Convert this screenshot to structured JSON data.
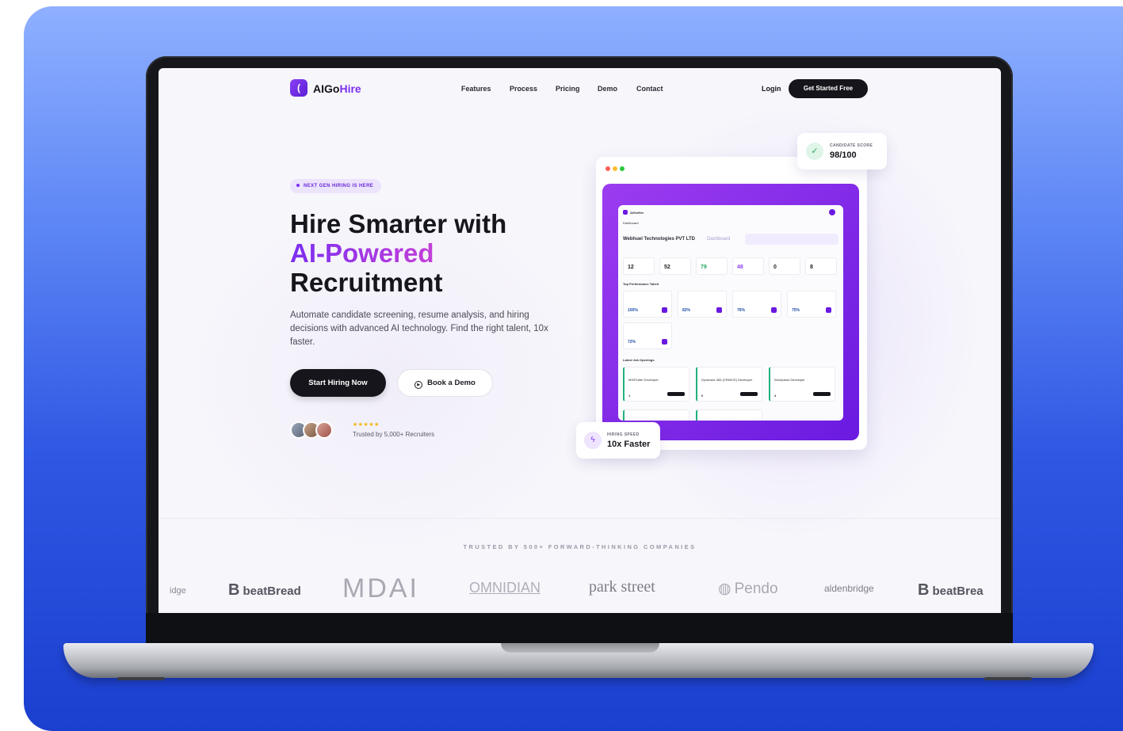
{
  "nav": {
    "logo_icon": "(",
    "logo_prefix": "AIGo",
    "logo_highlight": "Hire",
    "links": [
      "Features",
      "Process",
      "Pricing",
      "Demo",
      "Contact"
    ],
    "login": "Login",
    "cta": "Get Started Free"
  },
  "hero": {
    "badge": "NEXT GEN HIRING IS HERE",
    "headline_line1": "Hire Smarter with",
    "headline_line2": "AI-Powered",
    "headline_line3": "Recruitment",
    "subtext": "Automate candidate screening, resume analysis, and hiring decisions with advanced AI technology. Find the right talent, 10x faster.",
    "primary_button": "Start Hiring Now",
    "secondary_button": "Book a Demo",
    "stars": "★★★★★",
    "trusted": "Trusted by 5,000+ Recruiters"
  },
  "score_card": {
    "label": "CANDIDATE SCORE",
    "value": "98/100",
    "icon": "check-icon"
  },
  "speed_card": {
    "label": "HIRING SPEED",
    "value": "10x Faster",
    "icon": "lightning-icon"
  },
  "dashboard": {
    "brand": "AIGoHire",
    "section": "Dashboard",
    "company": "Webhuel Technologies PVT LTD",
    "company_suffix": "Dashboard",
    "kpis": [
      "12",
      "52",
      "79",
      "48",
      "0",
      "8"
    ],
    "top_talent": "Top Performance Talent",
    "talent_scores": [
      "100%",
      "82%",
      "76%",
      "75%",
      "72%"
    ],
    "jobs_title": "Latest Job Openings",
    "jobs": [
      "MS/Flutter Developer",
      "Dynamics 365 (CRM/CE) Developer",
      "Wordpress Developer"
    ],
    "job_counts": [
      "1",
      "0",
      "4"
    ]
  },
  "trusted_strip": {
    "title": "TRUSTED BY 500+ FORWARD-THINKING COMPANIES",
    "logos": [
      "idge",
      "beatBread",
      "MDAI",
      "OMNIDIAN",
      "park street",
      "Pendo",
      "aldenbridge",
      "beatBrea"
    ]
  },
  "colors": {
    "accent": "#7c2ff0",
    "dark": "#15151b",
    "background": "#2e57e3"
  }
}
